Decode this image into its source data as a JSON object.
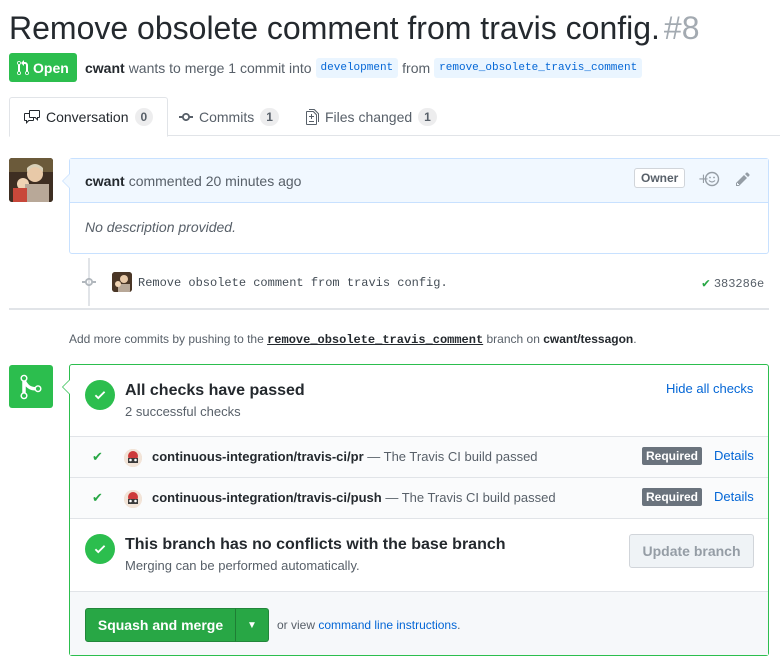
{
  "pr": {
    "title": "Remove obsolete comment from travis config.",
    "number": "#8",
    "state": "Open",
    "author": "cwant",
    "merge_text": "wants to merge 1 commit into",
    "base_branch": "development",
    "from_text": "from",
    "head_branch": "remove_obsolete_travis_comment"
  },
  "tabs": [
    {
      "label": "Conversation",
      "count": "0"
    },
    {
      "label": "Commits",
      "count": "1"
    },
    {
      "label": "Files changed",
      "count": "1"
    }
  ],
  "comment": {
    "author": "cwant",
    "action": "commented 20 minutes ago",
    "badge": "Owner",
    "body": "No description provided."
  },
  "commit": {
    "message": "Remove obsolete comment from travis config.",
    "sha": "383286e"
  },
  "push_hint": {
    "prefix": "Add more commits by pushing to the",
    "branch": "remove_obsolete_travis_comment",
    "middle": "branch on",
    "repo": "cwant/tessagon",
    "suffix": "."
  },
  "checks": {
    "title": "All checks have passed",
    "subtitle": "2 successful checks",
    "hide_label": "Hide all checks",
    "items": [
      {
        "context": "continuous-integration/travis-ci/pr",
        "desc": "— The Travis CI build passed",
        "required": "Required",
        "details": "Details"
      },
      {
        "context": "continuous-integration/travis-ci/push",
        "desc": "— The Travis CI build passed",
        "required": "Required",
        "details": "Details"
      }
    ]
  },
  "conflicts": {
    "title": "This branch has no conflicts with the base branch",
    "subtitle": "Merging can be performed automatically.",
    "update_label": "Update branch"
  },
  "merge": {
    "button_label": "Squash and merge",
    "or_view": "or view",
    "cli_link": "command line instructions",
    "suffix": "."
  },
  "colors": {
    "green": "#2cbe4e",
    "link": "#0366d6",
    "comment_border": "#c8e1ff"
  }
}
